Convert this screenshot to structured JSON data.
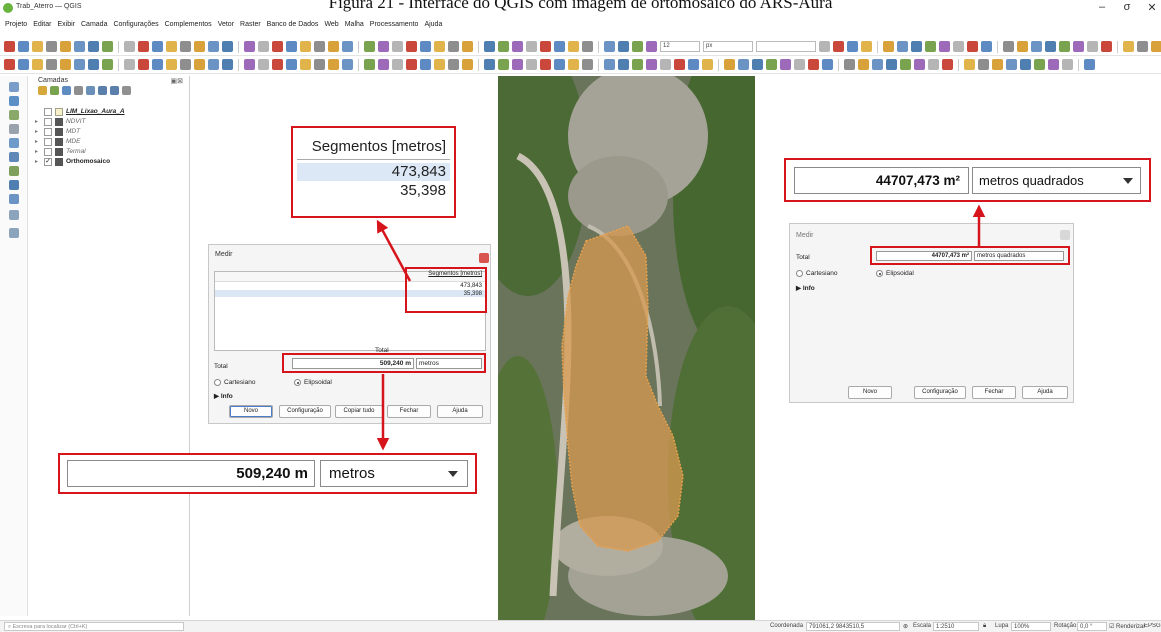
{
  "figure_caption": "Figura 21 - Interface do QGIS com imagem de ortomosaico do ARS-Aura",
  "window": {
    "title": "Trab_Aterro — QGIS",
    "minimize": "–",
    "maximize": "σ",
    "close": "✕"
  },
  "menu": [
    "Projeto",
    "Editar",
    "Exibir",
    "Camada",
    "Configurações",
    "Complementos",
    "Vetor",
    "Raster",
    "Banco de Dados",
    "Web",
    "Malha",
    "Processamento",
    "Ajuda"
  ],
  "toolbar": {
    "size_value": "12",
    "size_unit": "px"
  },
  "layers_panel": {
    "title": "Camadas",
    "layers": [
      {
        "name": "LIM_Lixao_Aura_A",
        "checked": false
      },
      {
        "name": "NDVIT",
        "checked": false
      },
      {
        "name": "MDT",
        "checked": false
      },
      {
        "name": "MDE",
        "checked": false
      },
      {
        "name": "Termal",
        "checked": false
      },
      {
        "name": "Orthomosaico",
        "checked": true
      }
    ]
  },
  "measure_line": {
    "title": "Medir",
    "column_header": "Segmentos [metros]",
    "segments": [
      "473,843",
      "35,398"
    ],
    "total_label": "Total",
    "total_value": "509,240 m",
    "unit": "metros",
    "radio_cartesian": "Cartesiano",
    "radio_ellipsoidal": "Elipsoidal",
    "info_label": "Info",
    "buttons": {
      "new": "Novo",
      "config": "Configuração",
      "copy": "Copiar tudo",
      "close": "Fechar",
      "help": "Ajuda"
    }
  },
  "measure_area": {
    "title": "Medir",
    "total_label": "Total",
    "total_value": "44707,473 m²",
    "unit": "metros quadrados",
    "radio_cartesian": "Cartesiano",
    "radio_ellipsoidal": "Elipsoidal",
    "info_label": "Info",
    "buttons": {
      "new": "Novo",
      "config": "Configuração",
      "close": "Fechar",
      "help": "Ajuda"
    }
  },
  "statusbar": {
    "search_placeholder": "Escreva para localizar (Ctrl+K)",
    "coord_label": "Coordenada",
    "coord_value": "791061,2 9843510,5",
    "scale_label": "Escala",
    "scale_value": "1:2510",
    "magnifier_label": "Lupa",
    "magnifier_value": "100%",
    "rotation_label": "Rotação",
    "rotation_value": "0,0 °",
    "render_label": "Renderizar",
    "crs_value": "EPSG:31982"
  },
  "colors": {
    "highlight_red": "#d6141c",
    "measure_polygon": "#e9a04a",
    "qgis_green": "#6bb33f"
  }
}
